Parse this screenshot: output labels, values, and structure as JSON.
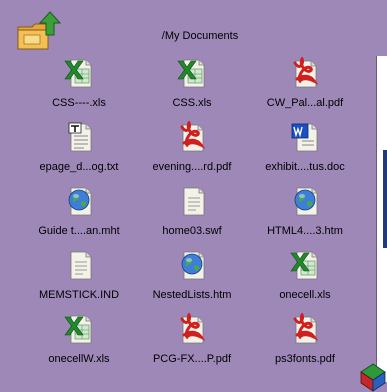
{
  "toolbar": {
    "path": "/My Documents"
  },
  "files": [
    {
      "name": "CSS----.xls",
      "type": "xls"
    },
    {
      "name": "CSS.xls",
      "type": "xls"
    },
    {
      "name": "CW_Pal...al.pdf",
      "type": "pdf"
    },
    {
      "name": "epage_d...og.txt",
      "type": "txt"
    },
    {
      "name": "evening....rd.pdf",
      "type": "pdf"
    },
    {
      "name": "exhibit....tus.doc",
      "type": "doc"
    },
    {
      "name": "Guide t....an.mht",
      "type": "web"
    },
    {
      "name": "home03.swf",
      "type": "generic"
    },
    {
      "name": "HTML4....3.htm",
      "type": "web"
    },
    {
      "name": "MEMSTICK.IND",
      "type": "generic"
    },
    {
      "name": "NestedLists.htm",
      "type": "web"
    },
    {
      "name": "onecell.xls",
      "type": "xls"
    },
    {
      "name": "onecellW.xls",
      "type": "xls"
    },
    {
      "name": "PCG-FX....P.pdf",
      "type": "pdf"
    },
    {
      "name": "ps3fonts.pdf",
      "type": "pdf"
    }
  ]
}
